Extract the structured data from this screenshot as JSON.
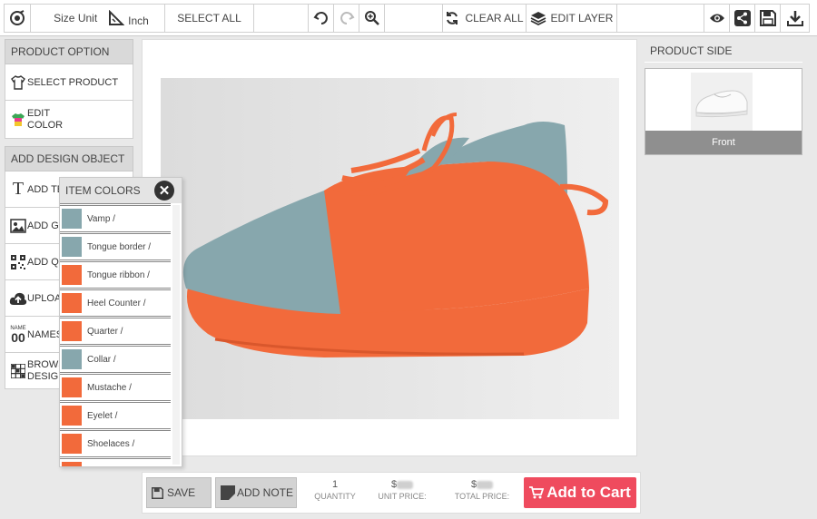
{
  "toolbar": {
    "size_unit_label": "Size Unit",
    "inch_label": "Inch",
    "select_all_label": "SELECT ALL",
    "clear_all_label": "CLEAR ALL",
    "edit_layer_label": "EDIT LAYER",
    "icons": [
      "logo-eye-icon",
      "ruler-icon",
      "undo-icon",
      "redo-icon",
      "zoom-in-icon",
      "refresh-icon",
      "layers-icon",
      "preview-eye-icon",
      "share-icon",
      "save-icon",
      "download-icon"
    ]
  },
  "left_panel": {
    "product_option_header": "PRODUCT OPTION",
    "select_product": "SELECT PRODUCT",
    "edit_color": "EDIT COLOR",
    "add_design_object_header": "ADD DESIGN OBJECT",
    "add_text": "ADD TEXT",
    "add_graphic": "ADD GRAPHIC",
    "add_qr": "ADD QR",
    "upload": "UPLOAD",
    "names": "NAMES",
    "browse_designs": "BROWSE DESIGNS",
    "names_icon_small": "NAME",
    "names_icon_big": "00"
  },
  "item_colors": {
    "title": "ITEM COLORS",
    "close_glyph": "✕",
    "items": [
      {
        "label": "Vamp  /",
        "color": "#87a7ad"
      },
      {
        "label": "Tongue border  /",
        "color": "#87a7ad"
      },
      {
        "label": "Tongue ribbon  /",
        "color": "#f26a3b"
      },
      {
        "label": "Heel Counter  /",
        "color": "#f26a3b"
      },
      {
        "label": "Quarter  /",
        "color": "#f26a3b"
      },
      {
        "label": "Collar  /",
        "color": "#87a7ad"
      },
      {
        "label": "Mustache  /",
        "color": "#f26a3b"
      },
      {
        "label": "Eyelet  /",
        "color": "#f26a3b"
      },
      {
        "label": "Shoelaces  /",
        "color": "#f26a3b"
      },
      {
        "label": "",
        "color": "#f26a3b"
      }
    ]
  },
  "right_panel": {
    "header": "PRODUCT SIDE",
    "side_label": "Front"
  },
  "bottom_bar": {
    "save_label": "SAVE",
    "add_note_label": "ADD NOTE",
    "quantity_value": "1",
    "quantity_label": "QUANTITY",
    "unit_price_prefix": "$",
    "unit_price_label": "UNIT PRICE:",
    "total_price_prefix": "$",
    "total_price_label": "TOTAL PRICE:",
    "add_to_cart_label": "Add to Cart"
  },
  "colors": {
    "accent_red": "#ef4b5e",
    "shoe_orange": "#f26a3b",
    "shoe_teal": "#87a7ad"
  }
}
